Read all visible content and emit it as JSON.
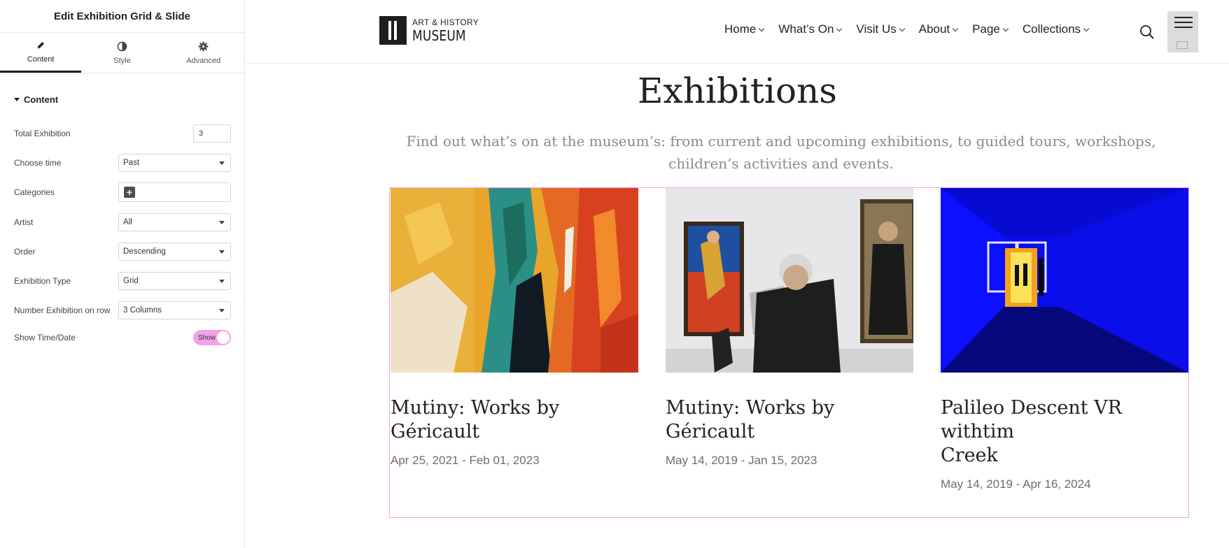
{
  "editor": {
    "title": "Edit Exhibition Grid & Slide",
    "tabs": [
      {
        "label": "Content",
        "icon": "pencil-icon",
        "active": true
      },
      {
        "label": "Style",
        "icon": "contrast-icon",
        "active": false
      },
      {
        "label": "Advanced",
        "icon": "gear-icon",
        "active": false
      }
    ],
    "section": "Content",
    "controls": {
      "total_exhibition": {
        "label": "Total Exhibition",
        "value": "3"
      },
      "choose_time": {
        "label": "Choose time",
        "value": "Past"
      },
      "categories": {
        "label": "Categories"
      },
      "artist": {
        "label": "Artist",
        "value": "All"
      },
      "order": {
        "label": "Order",
        "value": "Descending"
      },
      "exhibition_type": {
        "label": "Exhibition Type",
        "value": "Grid"
      },
      "number_on_row": {
        "label": "Number Exhibition on row",
        "value": "3 Columns"
      },
      "show_time_date": {
        "label": "Show Time/Date",
        "toggle_label": "Show",
        "on": true
      }
    }
  },
  "site": {
    "logo": {
      "small": "ART & HISTORY",
      "big": "MUSEUM"
    },
    "nav": [
      "Home",
      "What’s On",
      "Visit Us",
      "About",
      "Page",
      "Collections"
    ],
    "page_title": "Exhibitions",
    "intro": "Find out what’s on at the museum’s: from current and upcoming exhibitions, to guided tours, workshops, children’s activities and events.",
    "exhibitions": [
      {
        "title": "Mutiny: Works by\nGéricault",
        "date": "Apr 25, 2021 - Feb 01, 2023"
      },
      {
        "title": "Mutiny: Works by\nGéricault",
        "date": "May 14, 2019 - Jan 15, 2023"
      },
      {
        "title": "Palileo Descent VR withtim\nCreek",
        "date": "May 14, 2019 - Apr 16, 2024"
      }
    ]
  },
  "colors": {
    "accent": "#f2a3e8",
    "text": "#222222",
    "muted": "#8a8a8a"
  }
}
